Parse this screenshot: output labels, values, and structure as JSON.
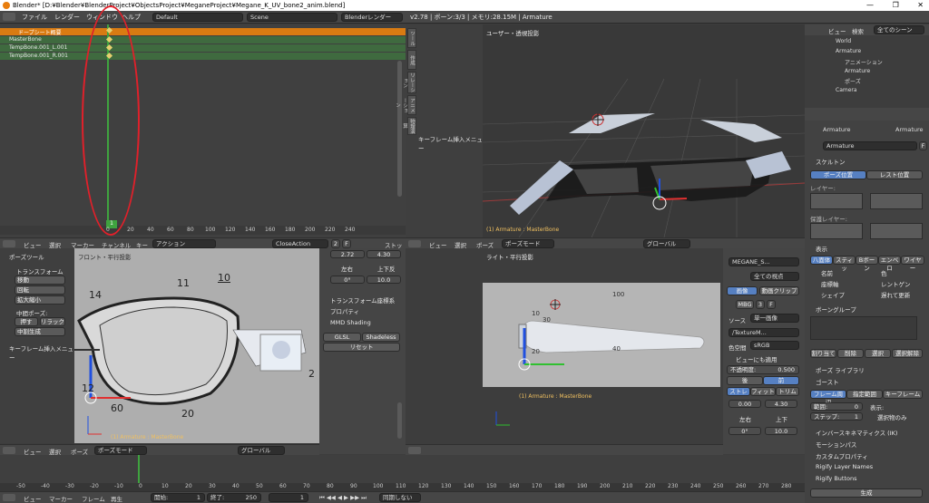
{
  "window": {
    "title": "Blender* [D:¥Blender¥BlenderProject¥ObjectsProject¥MeganeProject¥Megane_K_UV_bone2_anim.blend]",
    "controls": [
      "—",
      "❐",
      "✕"
    ]
  },
  "menubar": {
    "file": "ファイル",
    "render": "レンダー",
    "window": "ウィンドウ",
    "help": "ヘルプ",
    "layout": "Default",
    "scene": "Scene",
    "engine": "Blenderレンダー",
    "stats": "v2.78 | ボーン:3/3 | メモリ:28.15M | Armature"
  },
  "dopesheet": {
    "rows": [
      "ドープシート概要",
      "MasterBone",
      "TempBone.001_L.001",
      "TempBone.001_R.001"
    ],
    "ruler": [
      "0",
      "20",
      "40",
      "60",
      "80",
      "100",
      "120",
      "140",
      "160",
      "180",
      "200",
      "220",
      "240"
    ],
    "current_frame": "1",
    "header": {
      "view": "ビュー",
      "select": "選択",
      "marker": "マーカー",
      "channel": "チャンネル",
      "key": "キー",
      "mode": "アクション",
      "action": "CloseAction",
      "users": "2",
      "f": "F",
      "stash": "ストック"
    }
  },
  "viewport_top": {
    "label": "ユーザー・透視投影",
    "status": "(1) Armature : MasterBone",
    "vtabs": [
      "ツール",
      "作成",
      "リレーション",
      "アニメーション",
      "物理演算",
      "Grease",
      "Pencil"
    ],
    "keyframe_menu": "キーフレーム挿入メニュー",
    "header": {
      "view": "ビュー",
      "select": "選択",
      "pose": "ポーズ",
      "mode": "ポーズモード",
      "orientation": "グローバル"
    }
  },
  "viewport_front": {
    "label": "フロント・平行投影",
    "status": "(1) Armature : MasterBone",
    "pose_tools": "ポーズツール",
    "transform": "トランスフォーム",
    "move": "移動",
    "rotate": "回転",
    "scale": "拡大縮小",
    "inbetween": "中間ポーズ:",
    "push": "押す",
    "relax": "リラック",
    "breakdowner": "中割生成",
    "keyframe_menu": "キーフレーム挿入メニュー",
    "annotations": [
      "14",
      "11",
      "10",
      "12",
      "60",
      "20",
      "2"
    ],
    "header": {
      "view": "ビュー",
      "select": "選択",
      "pose": "ポーズ",
      "mode": "ポーズモード",
      "orientation": "グローバル"
    }
  },
  "props_mid": {
    "value_a": "2.72",
    "value_b": "4.30",
    "lr": "左右",
    "ud": "上下反",
    "deg": "0°",
    "ten": "10.0",
    "transform_cache": "トランスフォーム座標系",
    "properties": "プロパティ",
    "mmd": "MMD Shading",
    "glsl": "GLSL",
    "shadeless": "Shadeless",
    "reset": "リセット"
  },
  "viewport_right": {
    "label": "ライト・平行投影",
    "status": "(1) Armature : MasterBone",
    "annotations": [
      "100",
      "10",
      "30",
      "20",
      "40"
    ]
  },
  "image_panel": {
    "image_name": "MEGANE_S...",
    "display": "全ての視点",
    "image": "画像",
    "movie_clip": "動画クリップ",
    "mbg": "MBG",
    "three": "3",
    "f": "F",
    "source": "ソース",
    "source_val": "単一画像",
    "path": "/TextureM...",
    "colorspace_label": "色空間",
    "colorspace": "sRGB",
    "view_as_render": "ビューにも適用",
    "opacity_label": "不透明度:",
    "opacity": "0.500",
    "back": "後",
    "front": "前",
    "stretch": "ストレ",
    "fit": "フィット",
    "crop": "トリム",
    "offset_x": "0.00",
    "offset_y": "4.30",
    "flip_x": "左右",
    "flip_y": "上下",
    "rotation": "0°",
    "size": "10.0"
  },
  "outliner": {
    "view": "ビュー",
    "search": "検索",
    "filter": "全てのシーン",
    "items": [
      "World",
      "Armature",
      "アニメーション",
      "Armature",
      "ポーズ",
      "Camera"
    ]
  },
  "properties": {
    "path_a": "Armature",
    "path_b": "Armature",
    "name": "Armature",
    "f": "F",
    "skeleton": "スケルトン",
    "pose_position": "ポーズ位置",
    "rest_position": "レスト位置",
    "layers": "レイヤー:",
    "protected_layers": "保護レイヤー:",
    "display": "表示",
    "octahedral": "八面体",
    "stick": "スティッ",
    "bbone": "Bボーン",
    "envelope": "エンベロ",
    "wire": "ワイヤー",
    "names": "名前",
    "colors": "色",
    "axes": "座標軸",
    "xray": "レントゲン",
    "shapes": "シェイプ",
    "delay": "遅れて更新",
    "bone_groups": "ボーングループ",
    "assign": "割り当て",
    "remove": "削除",
    "select": "選択",
    "deselect": "選択解除",
    "pose_library": "ポーズ ライブラリ",
    "ghost": "ゴースト",
    "around_frame": "フレーム周辺",
    "in_range": "指定範囲",
    "keyframes": "キーフレーム",
    "range_label": "範囲:",
    "range": "0",
    "step_label": "ステップ:",
    "step": "1",
    "display_label": "表示:",
    "selected_only": "選択物のみ",
    "ik": "インバースキネマティクス (IK)",
    "motion_paths": "モーションパス",
    "custom_props": "カスタムプロパティ",
    "rigify_layers": "Rigify Layer Names",
    "rigify_buttons": "Rigify Buttons",
    "generate": "生成"
  },
  "timeline": {
    "ruler": [
      "-50",
      "-40",
      "-30",
      "-20",
      "-10",
      "0",
      "10",
      "20",
      "30",
      "40",
      "50",
      "60",
      "70",
      "80",
      "90",
      "100",
      "110",
      "120",
      "130",
      "140",
      "150",
      "160",
      "170",
      "180",
      "190",
      "200",
      "210",
      "220",
      "230",
      "240",
      "250",
      "260",
      "270",
      "280"
    ],
    "view": "ビュー",
    "marker": "マーカー",
    "frame": "フレーム",
    "play": "再生",
    "start_label": "開始:",
    "start": "1",
    "end_label": "終了:",
    "end": "250",
    "current": "1",
    "sync": "同期しない"
  },
  "colors": {
    "accent": "#5680c2",
    "timeline_green": "#3fa33f",
    "annotation_red": "#e0202a",
    "orange_row": "#d97b12"
  }
}
